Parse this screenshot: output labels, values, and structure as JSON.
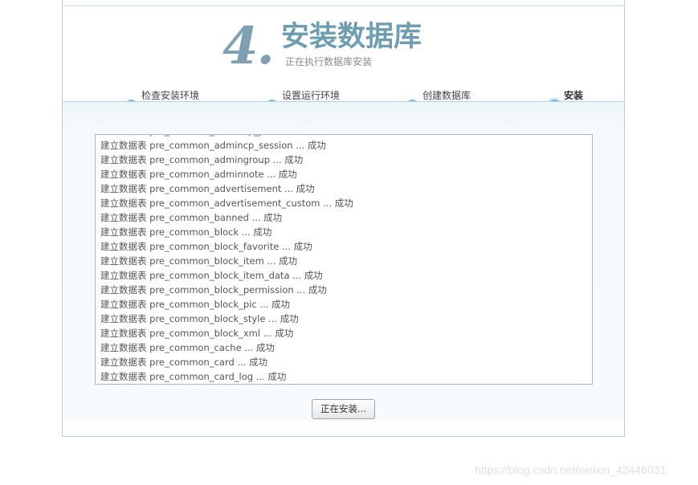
{
  "header": {
    "step_number": "4.",
    "title": "安装数据库",
    "subtitle": "正在执行数据库安装"
  },
  "steps": [
    {
      "label": "检查安装环境",
      "state": "done"
    },
    {
      "label": "设置运行环境",
      "state": "done"
    },
    {
      "label": "创建数据库",
      "state": "done"
    },
    {
      "label": "安装",
      "state": "current"
    }
  ],
  "log": {
    "lines": [
      "建立数据表 pre_common_admincp_perm ... 成功",
      "建立数据表 pre_common_admincp_session ... 成功",
      "建立数据表 pre_common_admingroup ... 成功",
      "建立数据表 pre_common_adminnote ... 成功",
      "建立数据表 pre_common_advertisement ... 成功",
      "建立数据表 pre_common_advertisement_custom ... 成功",
      "建立数据表 pre_common_banned ... 成功",
      "建立数据表 pre_common_block ... 成功",
      "建立数据表 pre_common_block_favorite ... 成功",
      "建立数据表 pre_common_block_item ... 成功",
      "建立数据表 pre_common_block_item_data ... 成功",
      "建立数据表 pre_common_block_permission ... 成功",
      "建立数据表 pre_common_block_pic ... 成功",
      "建立数据表 pre_common_block_style ... 成功",
      "建立数据表 pre_common_block_xml ... 成功",
      "建立数据表 pre_common_cache ... 成功",
      "建立数据表 pre_common_card ... 成功",
      "建立数据表 pre_common_card_log ... 成功"
    ]
  },
  "install_button": {
    "label": "正在安装..."
  },
  "watermark": "https://blog.csdn.net/weixin_42446031",
  "colors": {
    "accent": "#6e9db2",
    "step_dot": "#75b9da",
    "step_active": "#4aa6d9"
  }
}
